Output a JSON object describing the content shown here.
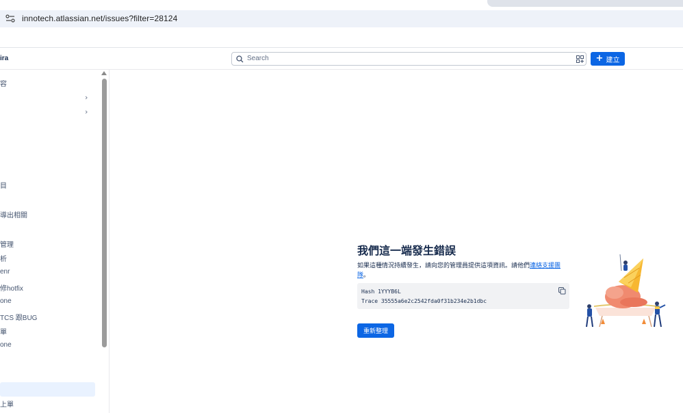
{
  "browser": {
    "url": "innotech.atlassian.net/issues?filter=28124"
  },
  "header": {
    "app_name": "ira",
    "search_placeholder": "Search",
    "create_label": "建立"
  },
  "sidebar": {
    "items": [
      {
        "label": "容"
      },
      {
        "label": ""
      },
      {
        "label": ""
      },
      {
        "label": "目"
      },
      {
        "label": "導出相關"
      },
      {
        "label": "管理"
      },
      {
        "label": "析"
      },
      {
        "label": "enr"
      },
      {
        "label": "修hotfix"
      },
      {
        "label": "one"
      },
      {
        "label": "TCS 跟BUG"
      },
      {
        "label": "單"
      },
      {
        "label": "one"
      },
      {
        "label": "上單"
      }
    ]
  },
  "error": {
    "title": "我們這一端發生錯誤",
    "desc_text": "如果這種情況持續發生，請向您的管理員提供這項資訊。請他們",
    "desc_link": "連絡支援團隊",
    "desc_end": "。",
    "hash_line": "Hash 1YYYB6L",
    "trace_line": "Trace 35555a6e2c2542fda0f31b234e2b1dbc",
    "reload_label": "重新整理"
  }
}
